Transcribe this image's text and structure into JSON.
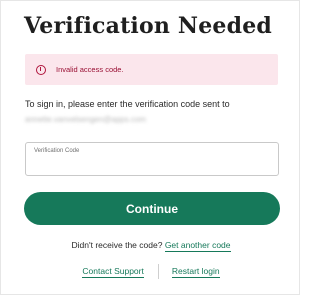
{
  "page": {
    "title": "Verification Needed"
  },
  "alert": {
    "icon": "alert-circle-icon",
    "message": "Invalid access code.",
    "colors": {
      "background": "#fbe6ec",
      "text": "#9a1034"
    }
  },
  "instructions": {
    "text": "To sign in, please enter the verification code sent to",
    "email": "annette.vanvelsengen@apps.com"
  },
  "code_field": {
    "label": "Verification Code",
    "value": ""
  },
  "actions": {
    "continue_label": "Continue",
    "resend_question": "Didn't receive the code?",
    "resend_link": "Get another code",
    "contact_support": "Contact Support",
    "restart_login": "Restart login"
  },
  "colors": {
    "accent": "#16795a"
  }
}
